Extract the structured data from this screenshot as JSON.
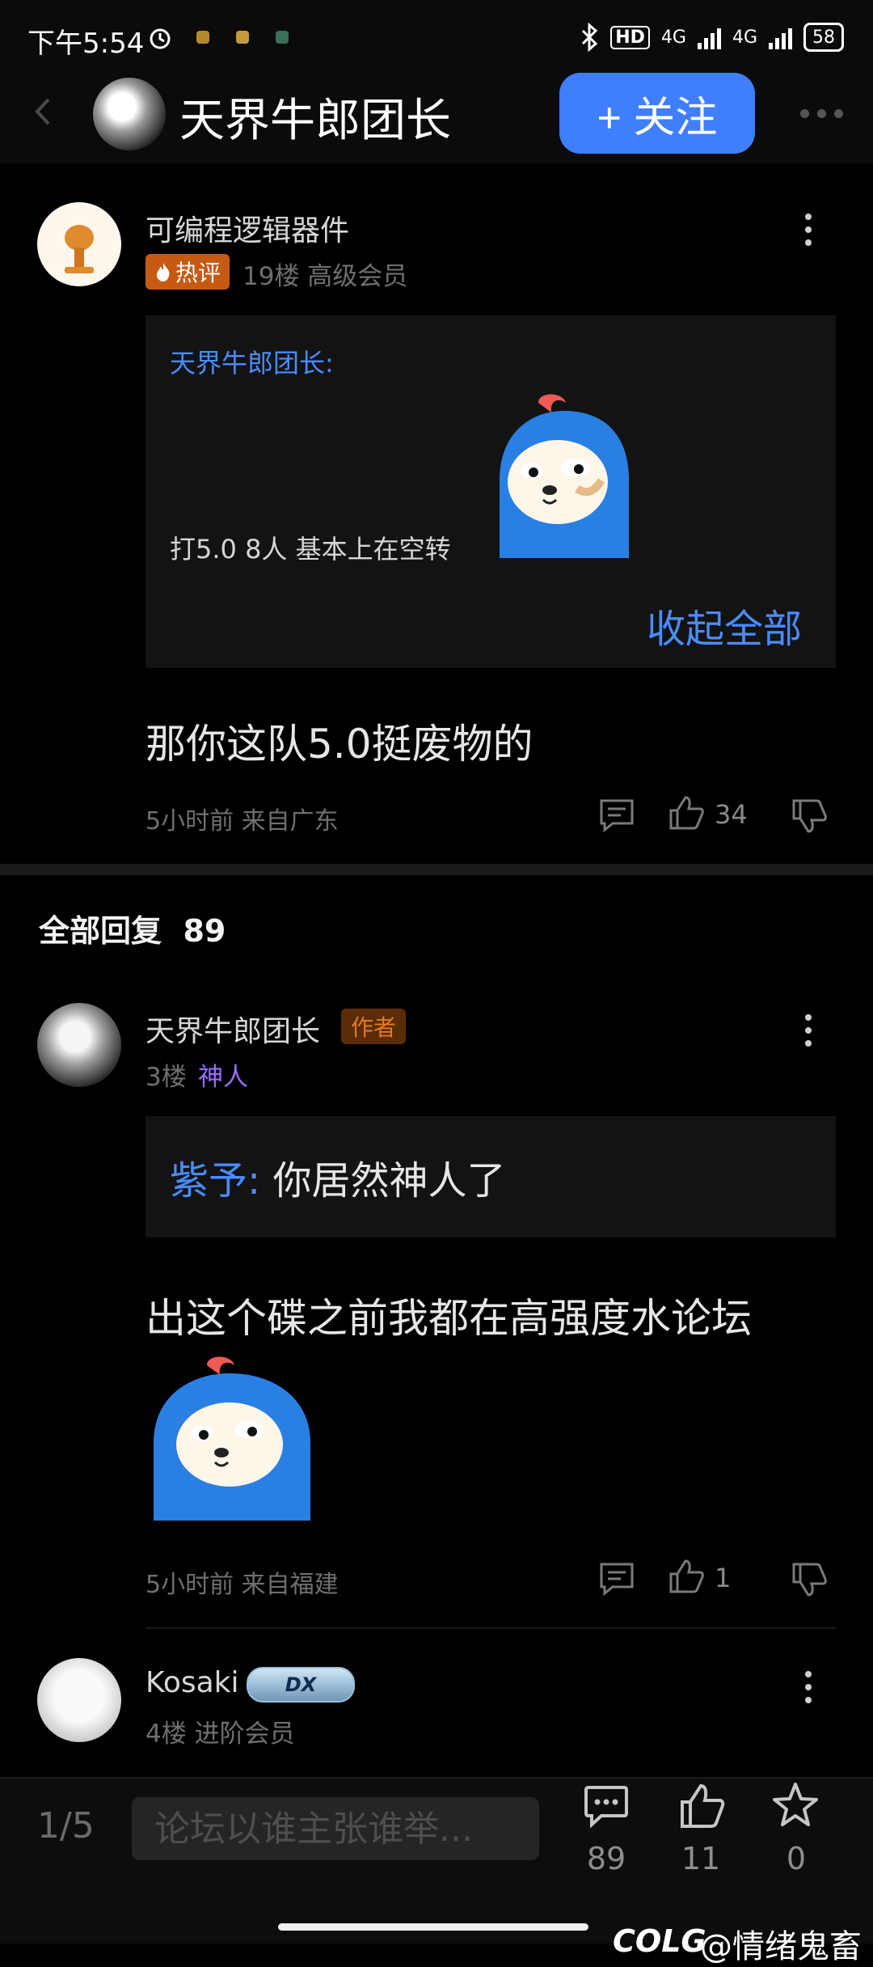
{
  "status_bar": {
    "time": "下午5:54",
    "network_hd": "HD",
    "network_4g_1": "4G",
    "network_4g_2": "4G",
    "battery": "58"
  },
  "header": {
    "title": "天界牛郎团长",
    "follow_label": "+ 关注"
  },
  "main_comment": {
    "user": "可编程逻辑器件",
    "hot_label": "热评",
    "meta": "19楼  高级会员",
    "quote_author": "天界牛郎团长:",
    "quote_text": "打5.0 8人  基本上在空转",
    "collapse_label": "收起全部",
    "text": "那你这队5.0挺废物的",
    "time_location": "5小时前 来自广东",
    "likes": "34"
  },
  "replies_section": {
    "title": "全部回复",
    "count": "89"
  },
  "reply_1": {
    "user": "天界牛郎团长",
    "badge": "作者",
    "floor": "3楼",
    "rank": "神人",
    "quote_author": "紫予:",
    "quote_text": " 你居然神人了",
    "text": "出这个碟之前我都在高强度水论坛",
    "time_location": "5小时前 来自福建",
    "likes": "1"
  },
  "reply_2": {
    "user": "Kosaki",
    "badge": "DX",
    "meta": "4楼  进阶会员"
  },
  "bottom_bar": {
    "page": "1/5",
    "input_placeholder": "论坛以谁主张谁举...",
    "comments_count": "89",
    "likes_count": "11",
    "favorites_count": "0"
  },
  "watermark": "@情绪鬼畜",
  "watermark_logo": "COLG",
  "colors": {
    "accent": "#3f7fff",
    "link": "#4a8cff",
    "hot": "#c75a12",
    "rank_purple": "#9b6cff"
  }
}
